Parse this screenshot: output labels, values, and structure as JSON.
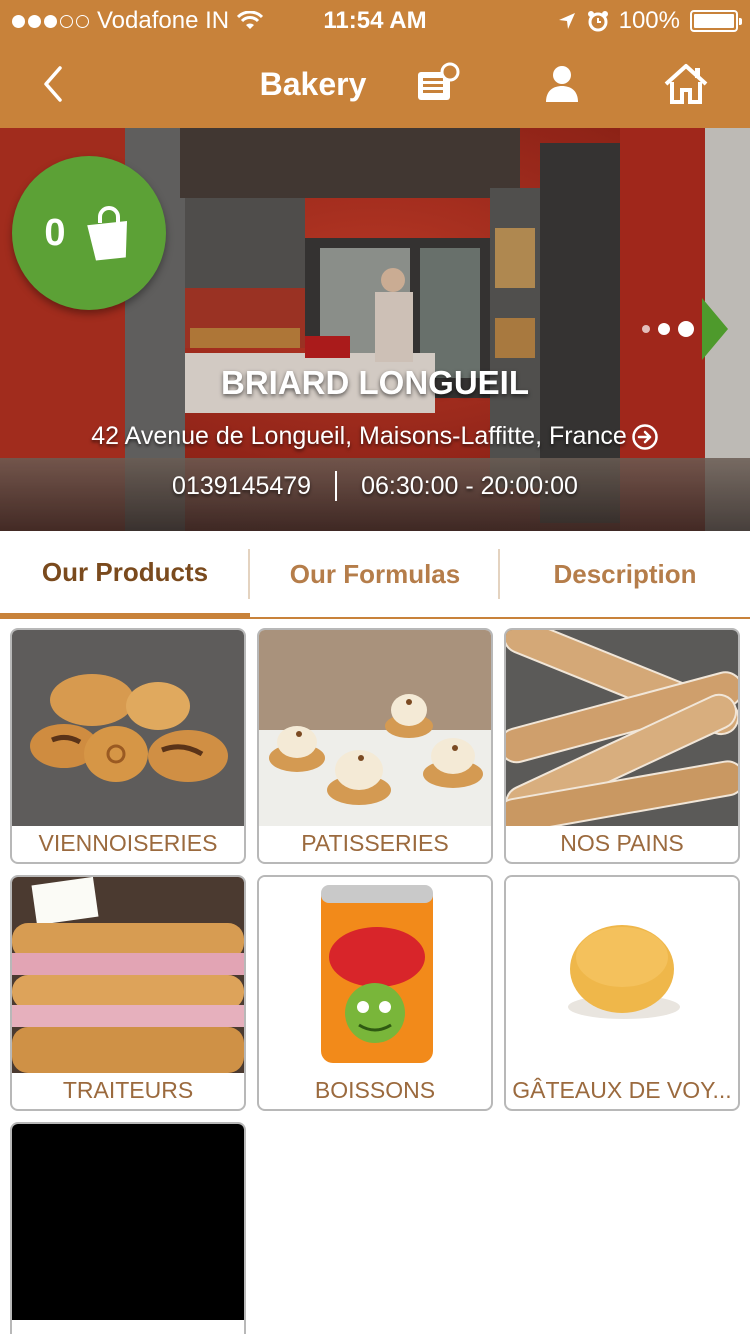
{
  "status_bar": {
    "carrier": "Vodafone IN",
    "time": "11:54 AM",
    "battery": "100%",
    "signal_bars": 3
  },
  "nav": {
    "title": "Bakery",
    "icons": [
      "back-chevron-icon",
      "menu-list-icon",
      "user-icon",
      "home-icon"
    ]
  },
  "cart": {
    "count": "0"
  },
  "store": {
    "name": "BRIARD LONGUEIL",
    "address": "42 Avenue de Longueil, Maisons-Laffitte, France",
    "phone": "0139145479",
    "hours": "06:30:00 - 20:00:00"
  },
  "tabs": [
    {
      "label": "Our Products",
      "active": true
    },
    {
      "label": "Our Formulas",
      "active": false
    },
    {
      "label": "Description",
      "active": false
    }
  ],
  "products": [
    {
      "label": "VIENNOISERIES"
    },
    {
      "label": "PATISSERIES"
    },
    {
      "label": "NOS PAINS"
    },
    {
      "label": "TRAITEURS"
    },
    {
      "label": "BOISSONS"
    },
    {
      "label": "GÂTEAUX DE VOY..."
    },
    {
      "label": ""
    }
  ],
  "colors": {
    "brand_orange": "#c8823a",
    "cart_green": "#5ca136",
    "label_brown": "#9b6a3e",
    "active_tab_text": "#7a4a1d"
  }
}
